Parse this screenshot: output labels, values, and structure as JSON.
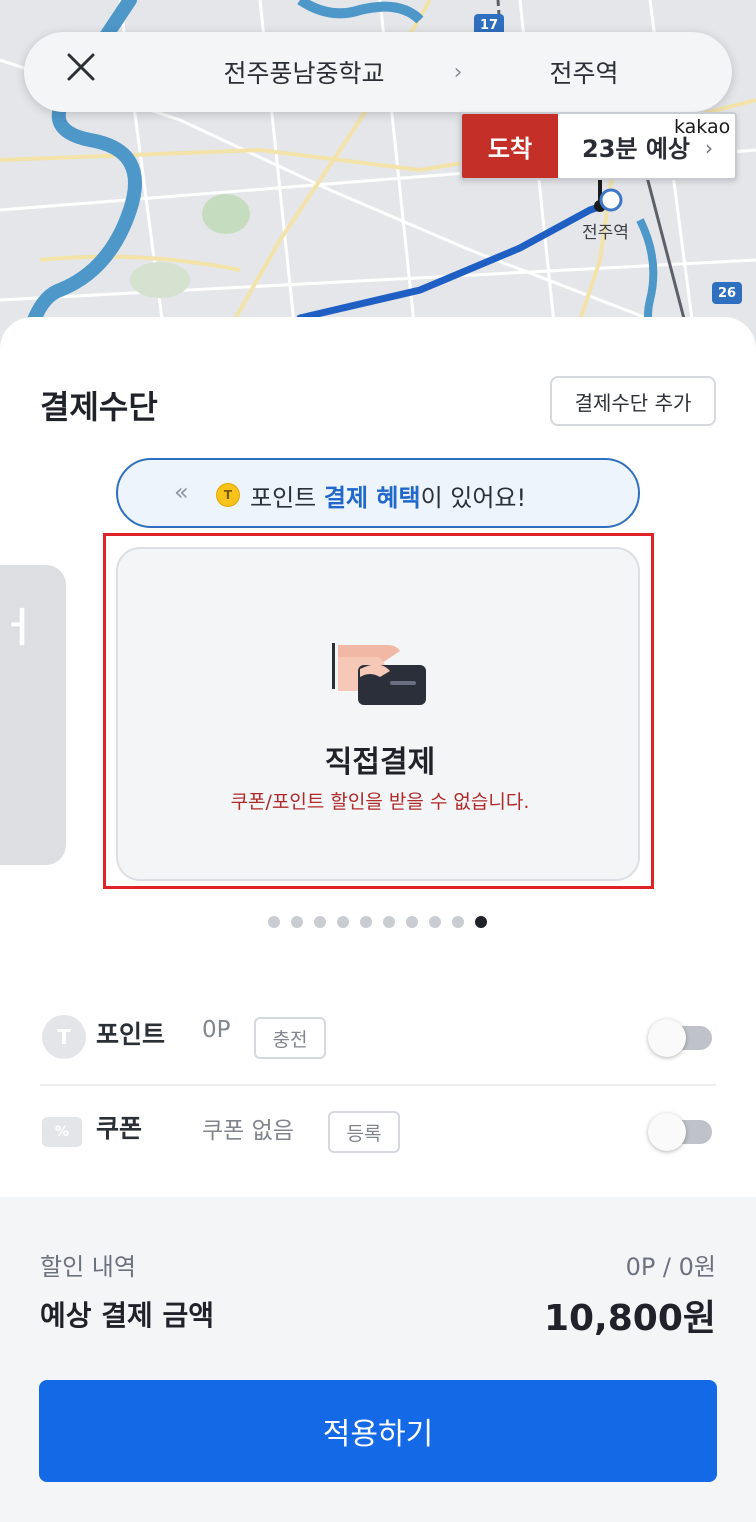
{
  "map": {
    "route_from": "전주풍남중학교",
    "route_separator": "›",
    "route_to": "전주역",
    "eta_tag": "도착",
    "eta_text": "23분 예상",
    "eta_chevron": "›",
    "provider": "kakao",
    "station_label": "전주역",
    "road_badge_top": "17",
    "road_badge_right": "26"
  },
  "sheet": {
    "title": "결제수단",
    "add_method_label": "결제수단 추가",
    "banner": {
      "chevron": "«",
      "coin_symbol": "T",
      "text_before": "포인트 ",
      "text_highlight": "결제 혜택",
      "text_after": "이 있어요!"
    },
    "prev_card_glyph": "ㅓ",
    "card": {
      "title": "직접결제",
      "subtitle": "쿠폰/포인트 할인을 받을 수 없습니다."
    },
    "pager": {
      "count": 10,
      "active_index": 9
    },
    "options": {
      "points": {
        "icon_symbol": "T",
        "label": "포인트",
        "value": "0P",
        "button": "충전",
        "enabled": false
      },
      "coupon": {
        "icon_symbol": "%",
        "label": "쿠폰",
        "value": "쿠폰 없음",
        "button": "등록",
        "enabled": false
      }
    },
    "summary": {
      "discount_label": "할인 내역",
      "discount_value": "0P / 0원",
      "total_label": "예상 결제 금액",
      "total_value": "10,800원"
    },
    "apply_label": "적용하기"
  },
  "colors": {
    "accent_blue": "#1469e6",
    "eta_red": "#c42f28",
    "highlight_red": "#e02229",
    "warning_text": "#b02a2a"
  }
}
